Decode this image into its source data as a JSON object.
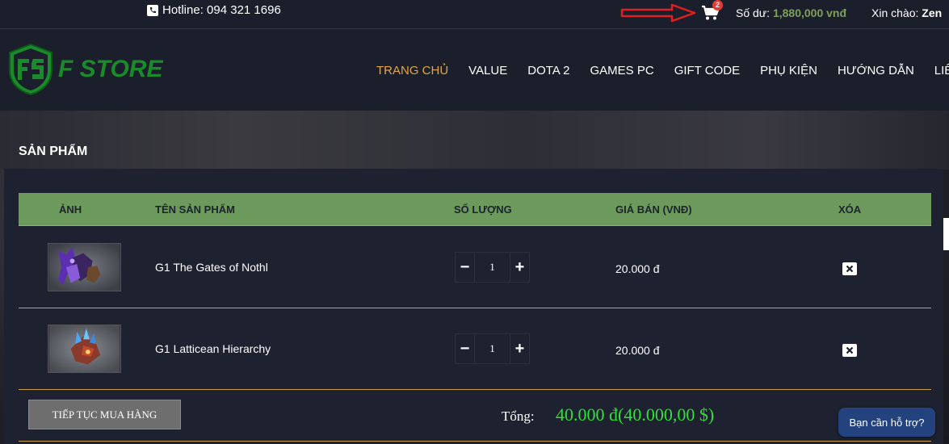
{
  "topbar": {
    "hotline": "Hotline: 094 321 1696",
    "cart_count": "2",
    "balance_label": "Số dư:",
    "balance_value": "1,880,000 vnđ",
    "greeting_label": "Xin chào:",
    "greeting_user": "Zen"
  },
  "header": {
    "logo_text": "F STORE",
    "nav": [
      "TRANG CHỦ",
      "VALUE",
      "DOTA 2",
      "GAMES PC",
      "GIFT CODE",
      "PHỤ KIỆN",
      "HƯỚNG DẪN",
      "LIÊN HỆ"
    ]
  },
  "section_title": "SẢN PHẨM",
  "table": {
    "headers": [
      "ẢNH",
      "TÊN SẢN PHẨM",
      "SỐ LƯỢNG",
      "GIÁ BÁN (VNĐ)",
      "XÓA"
    ],
    "rows": [
      {
        "name": "G1 The Gates of Nothl",
        "qty": "1",
        "price": "20.000 đ"
      },
      {
        "name": "G1 Latticean Hierarchy",
        "qty": "1",
        "price": "20.000 đ"
      }
    ]
  },
  "footer": {
    "continue_label": "TIẾP TỤC MUA HÀNG",
    "total_label": "Tổng:",
    "total_value": "40.000 đ(40.000,00 $)"
  },
  "support_label": "Bạn cần hỗ trợ?",
  "colors": {
    "accent_green": "#6b9a5c",
    "active_nav": "#e0a64a",
    "total_green": "#32e03a",
    "row_border": "#c9a14a"
  }
}
